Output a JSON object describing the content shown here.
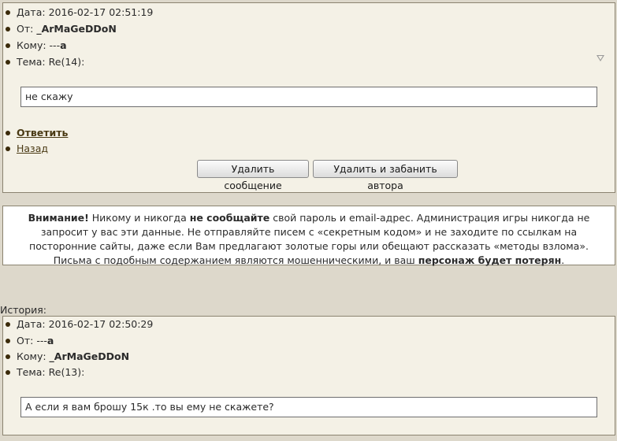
{
  "message": {
    "date_label": "Дата:",
    "date_value": "2016-02-17 02:51:19",
    "from_label": "От:",
    "from_value": "_ArMaGeDDoN",
    "to_label": "Кому:",
    "to_value_dash": "---",
    "to_value_bold": "a",
    "subject_label": "Тема:",
    "subject_value": "Re(14):",
    "body": "не скажу",
    "reply_link": "Ответить",
    "back_link": "Назад",
    "delete_button": "Удалить сообщение",
    "delete_ban_button": "Удалить и забанить автора"
  },
  "warning": {
    "p1": "Внимание!",
    "p2": " Никому и никогда ",
    "p3": "не сообщайте",
    "p4": " свой пароль и email-адрес. Администрация игры никогда не запросит у вас эти данные. Не отправляйте писем с «секретным кодом» и не заходите по ссылкам на посторонние сайты, даже если Вам предлагают золотые горы или обещают рассказать «методы взлома». Письма с подобным содержанием являются мошенническими, и ваш ",
    "p5": "персонаж будет потерян",
    "p6": "."
  },
  "history": {
    "label": "История:",
    "date_label": "Дата:",
    "date_value": "2016-02-17 02:50:29",
    "from_label": "От:",
    "from_value_dash": "---",
    "from_value_bold": "a",
    "to_label": "Кому:",
    "to_value": "_ArMaGeDDoN",
    "subject_label": "Тема:",
    "subject_value": "Re(13):",
    "body": "А если я вам брошу 15к .то вы ему не скажете?"
  }
}
